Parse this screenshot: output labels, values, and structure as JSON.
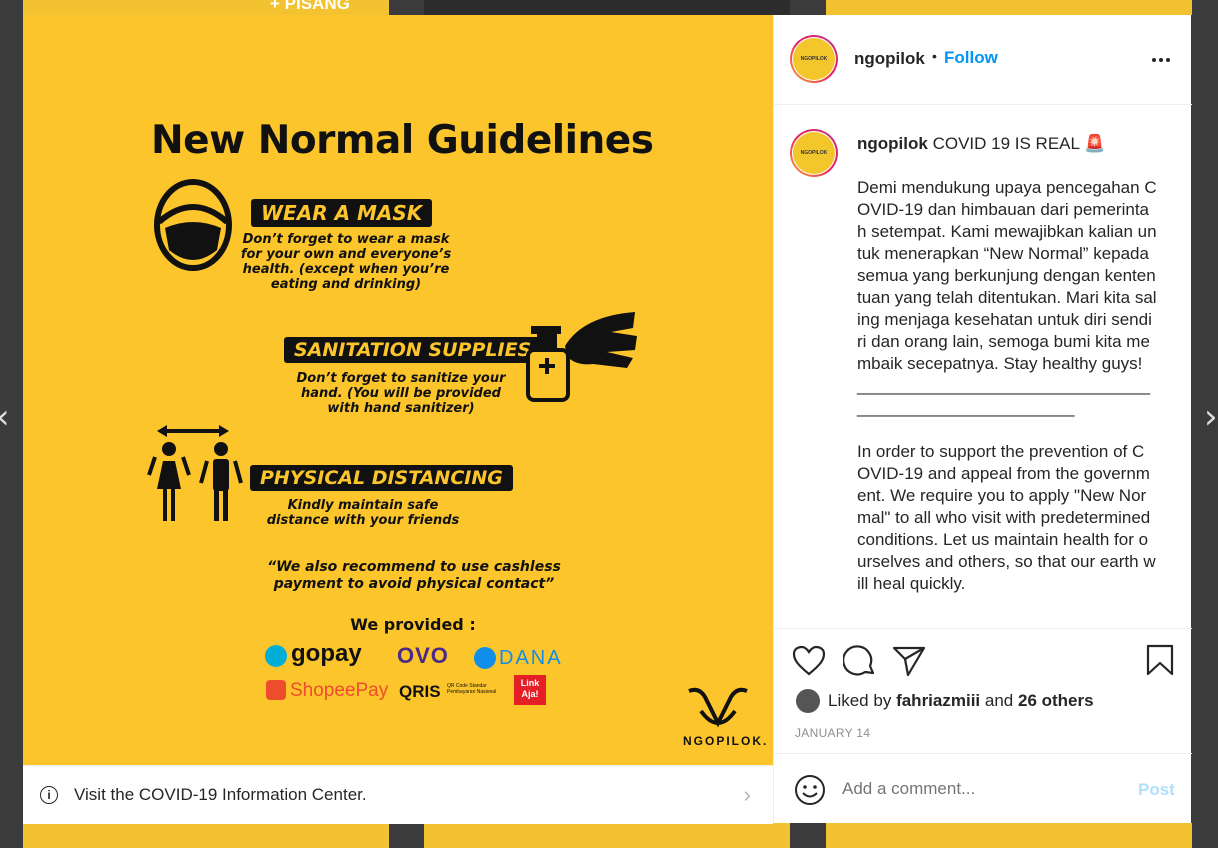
{
  "post": {
    "username": "ngopilok",
    "follow_label": "Follow",
    "separator": "•",
    "avatar_text": "NGOPILOK",
    "caption_username": "ngopilok",
    "caption_headline": "COVID 19 IS REAL 🚨",
    "caption_body": "Demi mendukung upaya pencegahan COVID-19 dan himbauan dari pemerintah setempat. Kami mewajibkan kalian untuk menerapkan “New Normal” kepada semua yang berkunjung dengan kententuan yang telah ditentukan. Mari kita saling menjaga kesehatan untuk diri sendiri dan orang lain, semoga bumi kita membaik secepatnya. Stay healthy guys!\n______________________________________________________\n\nIn order to support the prevention of COVID-19 and appeal from the government. We require you to apply \"New Normal\" to all who visit with predetermined conditions. Let us maintain health for ourselves and others, so that our earth will heal quickly.",
    "liked_by_prefix": "Liked by",
    "liked_by_user": "fahriazmiii",
    "liked_by_and": "and",
    "liked_by_others": "26 others",
    "date": "JANUARY 14",
    "comment_placeholder": "Add a comment...",
    "post_button": "Post"
  },
  "covid_bar": {
    "text": "Visit the COVID-19 Information Center.",
    "info_glyph": "i",
    "chevron": "›"
  },
  "nav": {
    "prev": "‹",
    "next": "›"
  },
  "background": {
    "peek_text": "+ PISANG"
  },
  "graphic": {
    "title": "New Normal Guidelines",
    "rule1_title": "WEAR A MASK",
    "rule1_desc": "Don’t forget to wear a mask for your own and everyone’s health. (except when you’re eating and drinking)",
    "rule2_title": "SANITATION SUPPLIES",
    "rule2_desc": "Don’t forget to sanitize your hand. (You will be provided with hand sanitizer)",
    "rule3_title": "PHYSICAL DISTANCING",
    "rule3_desc": "Kindly maintain safe distance with your friends",
    "quote": "“We also recommend to use cashless payment to avoid physical contact”",
    "provided": "We provided :",
    "pay": [
      "gopay",
      "OVO",
      "DANA",
      "ShopeePay",
      "QRIS",
      "QR Code Standar Pembayaran Nasional",
      "Link Aja!"
    ],
    "brand": "NGOPILOK."
  },
  "colors": {
    "brand_yellow": "#fbc52b",
    "follow_blue": "#0095f6",
    "post_blue": "#b2dffc"
  },
  "icons": [
    "heart-icon",
    "comment-icon",
    "share-icon",
    "bookmark-icon",
    "more-icon",
    "emoji-icon",
    "info-icon",
    "chevron-right-icon"
  ]
}
